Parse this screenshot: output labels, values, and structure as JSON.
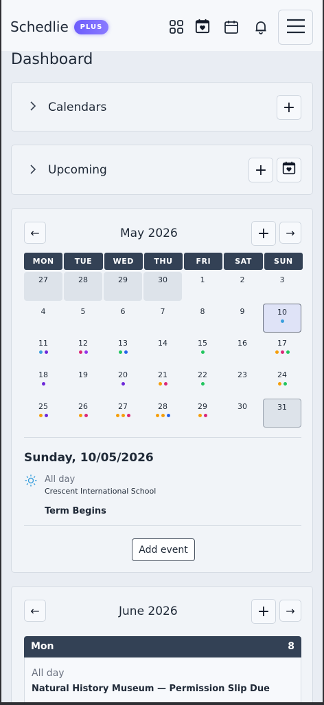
{
  "header": {
    "app_name": "Schedlie",
    "badge": "PLUS",
    "icons": [
      "grid-icon",
      "favorite-calendar-icon",
      "calendar-icon",
      "bell-icon",
      "hamburger-menu-icon"
    ]
  },
  "page_title": "Dashboard",
  "sections": {
    "calendars": {
      "label": "Calendars",
      "add": "+"
    },
    "upcoming": {
      "label": "Upcoming",
      "add": "+"
    }
  },
  "month_card": {
    "prev": "←",
    "next": "→",
    "add": "+",
    "title": "May 2026",
    "weekdays": [
      "MON",
      "TUE",
      "WED",
      "THU",
      "FRI",
      "SAT",
      "SUN"
    ],
    "weeks": [
      [
        {
          "d": "27",
          "s": "other",
          "dots": []
        },
        {
          "d": "28",
          "s": "other",
          "dots": []
        },
        {
          "d": "29",
          "s": "other",
          "dots": []
        },
        {
          "d": "30",
          "s": "other",
          "dots": []
        },
        {
          "d": "1",
          "dots": []
        },
        {
          "d": "2",
          "dots": []
        },
        {
          "d": "3",
          "dots": []
        }
      ],
      [
        {
          "d": "4",
          "dots": []
        },
        {
          "d": "5",
          "dots": []
        },
        {
          "d": "6",
          "dots": []
        },
        {
          "d": "7",
          "dots": []
        },
        {
          "d": "8",
          "dots": []
        },
        {
          "d": "9",
          "dots": []
        },
        {
          "d": "10",
          "s": "today",
          "dots": [
            "#3b9fdc"
          ]
        }
      ],
      [
        {
          "d": "11",
          "dots": [
            "#3b9fdc",
            "#6d28d9"
          ]
        },
        {
          "d": "12",
          "dots": [
            "#db2777",
            "#9333ea"
          ]
        },
        {
          "d": "13",
          "dots": [
            "#22c55e",
            "#2563eb"
          ]
        },
        {
          "d": "14",
          "dots": []
        },
        {
          "d": "15",
          "dots": [
            "#22c55e"
          ]
        },
        {
          "d": "16",
          "dots": []
        },
        {
          "d": "17",
          "dots": [
            "#f59e0b",
            "#db2777",
            "#22c55e"
          ]
        }
      ],
      [
        {
          "d": "18",
          "dots": [
            "#6d28d9"
          ]
        },
        {
          "d": "19",
          "dots": []
        },
        {
          "d": "20",
          "dots": [
            "#6d28d9"
          ]
        },
        {
          "d": "21",
          "dots": [
            "#f59e0b",
            "#db2777"
          ]
        },
        {
          "d": "22",
          "dots": [
            "#22c55e"
          ]
        },
        {
          "d": "23",
          "dots": []
        },
        {
          "d": "24",
          "dots": [
            "#f59e0b",
            "#22c55e"
          ]
        }
      ],
      [
        {
          "d": "25",
          "dots": [
            "#f59e0b",
            "#6d28d9"
          ]
        },
        {
          "d": "26",
          "dots": [
            "#f59e0b",
            "#db2777"
          ]
        },
        {
          "d": "27",
          "dots": [
            "#f59e0b",
            "#f59e0b",
            "#db2777"
          ]
        },
        {
          "d": "28",
          "dots": [
            "#f59e0b",
            "#f59e0b",
            "#2563eb"
          ]
        },
        {
          "d": "29",
          "dots": [
            "#f59e0b",
            "#db2777"
          ]
        },
        {
          "d": "30",
          "dots": []
        },
        {
          "d": "31",
          "s": "sel31",
          "dots": []
        }
      ]
    ],
    "selected": {
      "date": "Sunday, 10/05/2026",
      "all_day": "All day",
      "calendar": "Crescent International School",
      "event": "Term Begins"
    },
    "add_event": "Add event"
  },
  "june_card": {
    "prev": "←",
    "next": "→",
    "add": "+",
    "title": "June 2026",
    "day_label": "Mon",
    "day_number": "8",
    "all_day": "All day",
    "event": "Natural History Museum — Permission Slip Due"
  },
  "colors": {
    "accent": "#6d5dfc",
    "header_dark": "#334155",
    "background": "#e9edf3"
  }
}
